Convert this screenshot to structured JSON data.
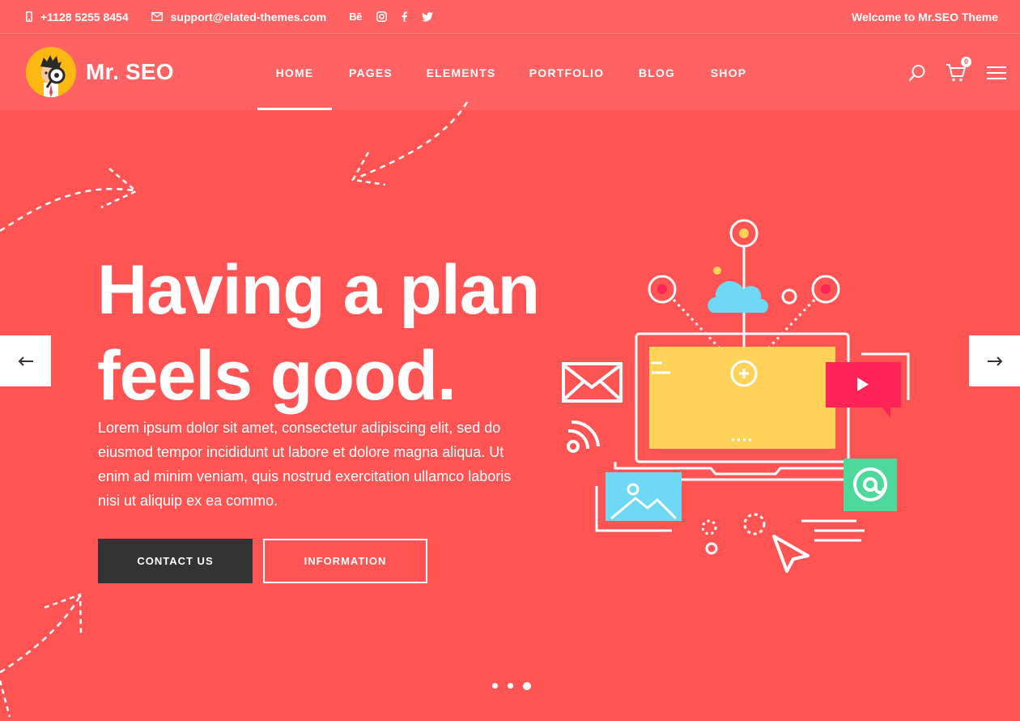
{
  "topbar": {
    "phone": "+1128 5255 8454",
    "email": "support@elated-themes.com",
    "welcome": "Welcome to Mr.SEO Theme",
    "socials": [
      "Bē",
      "instagram-icon",
      "facebook-icon",
      "twitter-icon"
    ]
  },
  "header": {
    "logo_text": "Mr. SEO",
    "nav": [
      {
        "label": "Home",
        "active": true
      },
      {
        "label": "Pages",
        "active": false
      },
      {
        "label": "Elements",
        "active": false
      },
      {
        "label": "Portfolio",
        "active": false
      },
      {
        "label": "Blog",
        "active": false
      },
      {
        "label": "Shop",
        "active": false
      }
    ],
    "cart_count": "0",
    "icons": [
      "search-icon",
      "cart-icon",
      "hamburger-menu-icon"
    ]
  },
  "hero": {
    "title_line1": "Having a plan",
    "title_line2": "feels good.",
    "text": "Lorem ipsum dolor sit amet, consectetur adipiscing elit, sed do eiusmod tempor incididunt ut labore et dolore magna aliqua. Ut enim ad minim veniam, quis nostrud exercitation ullamco laboris nisi ut aliquip ex ea commo.",
    "buttons": {
      "contact": "Contact Us",
      "info": "Information"
    },
    "slider": {
      "prev_icon": "arrow-left-icon",
      "next_icon": "arrow-right-icon",
      "slides": 3,
      "active_slide": 3
    }
  },
  "colors": {
    "background": "#ff5454",
    "header": "#ff6262",
    "dark_button": "#333333",
    "illustration_yellow": "#ffd25a",
    "illustration_blue": "#6fd8f5",
    "illustration_pink": "#ff2358",
    "illustration_green": "#4cd99b"
  }
}
